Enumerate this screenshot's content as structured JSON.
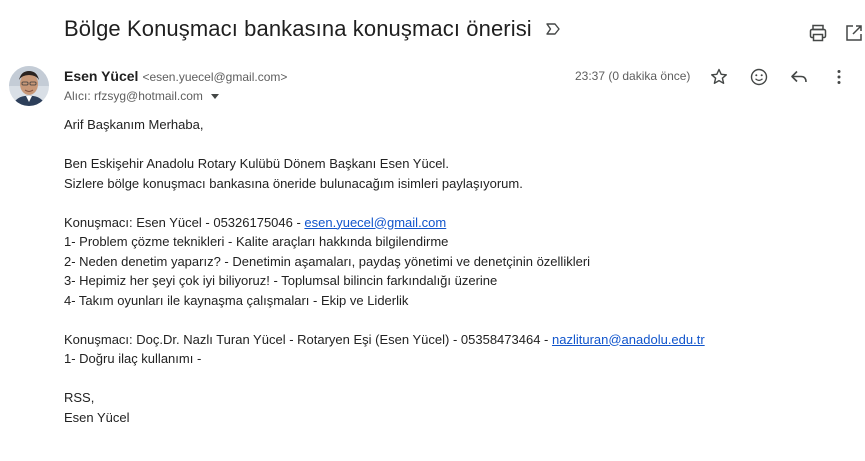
{
  "subject": "Bölge Konuşmacı bankasına konuşmacı önerisi",
  "colors": {
    "accent_link": "#1155cc",
    "text": "#222222",
    "muted": "#5e5e5e",
    "icon": "#444746"
  },
  "icons": {
    "label": "label-outline-icon",
    "print": "print-icon",
    "open_new_window": "open-in-new-icon",
    "star": "star-outline-icon",
    "emoji": "emoji-reaction-icon",
    "reply": "reply-icon",
    "more": "more-vertical-icon",
    "recipient_caret": "caret-down-icon"
  },
  "sender": {
    "name": "Esen Yücel",
    "email": "<esen.yuecel@gmail.com>"
  },
  "recipient": {
    "text": "Alıcı: rfzsyg@hotmail.com"
  },
  "timestamp": "23:37 (0 dakika önce)",
  "body": {
    "greeting": "Arif Başkanım Merhaba,",
    "intro_line1": "Ben Eskişehir Anadolu Rotary Kulübü Dönem Başkanı Esen Yücel.",
    "intro_line2": "Sizlere bölge konuşmacı bankasına öneride bulunacağım isimleri paylaşıyorum.",
    "speaker1": {
      "prefix": "Konuşmacı: Esen Yücel - 05326175046 - ",
      "email": "esen.yuecel@gmail.com",
      "topics": [
        "1- Problem çözme teknikleri - Kalite araçları hakkında bilgilendirme",
        "2- Neden denetim yaparız? - Denetimin aşamaları, paydaş yönetimi ve denetçinin özellikleri",
        "3- Hepimiz her şeyi çok iyi biliyoruz! - Toplumsal bilincin farkındalığı üzerine",
        "4- Takım oyunları ile kaynaşma çalışmaları - Ekip ve Liderlik"
      ]
    },
    "speaker2": {
      "prefix": "Konuşmacı: Doç.Dr. Nazlı Turan Yücel - Rotaryen Eşi (Esen Yücel) - 05358473464 - ",
      "email": "nazlituran@anadolu.edu.tr",
      "topics": [
        "1- Doğru ilaç kullanımı -"
      ]
    },
    "closing": "RSS,",
    "signature": "Esen Yücel"
  }
}
